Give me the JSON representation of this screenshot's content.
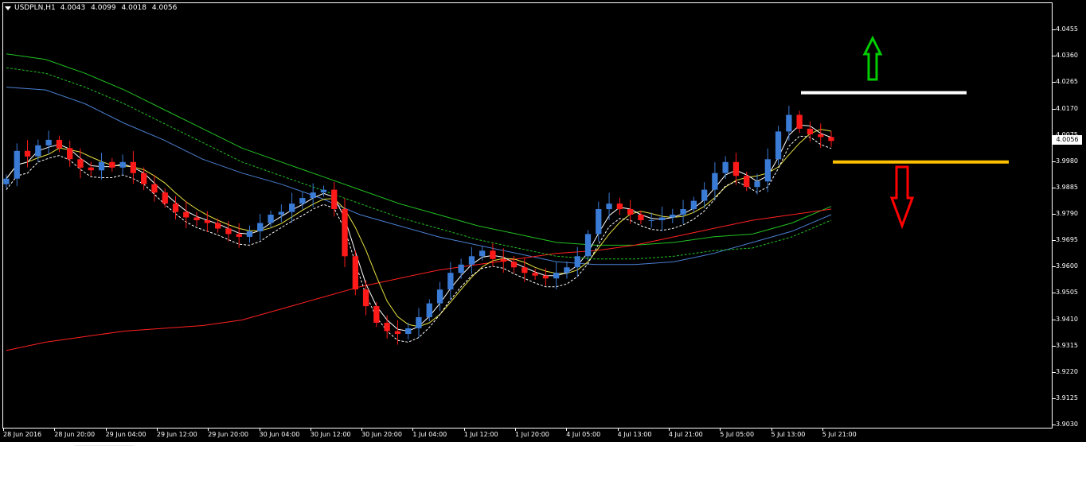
{
  "header": {
    "symbol": "USDPLN,H1",
    "open": "4.0043",
    "high": "4.0099",
    "low": "4.0018",
    "close": "4.0056"
  },
  "price_axis": {
    "labels": [
      "4.0455",
      "4.0360",
      "4.0265",
      "4.0170",
      "4.0075",
      "3.9980",
      "3.9885",
      "3.9790",
      "3.9695",
      "3.9600",
      "3.9505",
      "3.9410",
      "3.9315",
      "3.9220",
      "3.9125",
      "3.9030"
    ],
    "current_price": "4.0056"
  },
  "time_axis": {
    "labels": [
      "28 Jun 2016",
      "28 Jun 20:00",
      "29 Jun 04:00",
      "29 Jun 12:00",
      "29 Jun 20:00",
      "30 Jun 04:00",
      "30 Jun 12:00",
      "30 Jun 20:00",
      "1 Jul 04:00",
      "1 Jul 12:00",
      "1 Jul 20:00",
      "4 Jul 05:00",
      "4 Jul 13:00",
      "4 Jul 21:00",
      "5 Jul 05:00",
      "5 Jul 13:00",
      "5 Jul 21:00"
    ]
  },
  "colors": {
    "background": "#000000",
    "bull_candle": "#3a7bd5",
    "bear_candle": "#ff1a1a",
    "ma_green": "#22c022",
    "ma_red": "#ff2020",
    "ma_blue": "#4a7fd0",
    "ma_yellow": "#e8e040",
    "ma_white": "#ffffff",
    "resistance_line": "#ffffff",
    "support_line": "#ffc000",
    "up_arrow": "#00cc00",
    "down_arrow": "#ff0000"
  },
  "annotations": {
    "resistance_price": 4.023,
    "support_price": 3.998,
    "up_arrow_icon": "up-arrow-icon",
    "down_arrow_icon": "down-arrow-icon"
  },
  "chart_data": {
    "type": "candlestick",
    "ylim": [
      3.903,
      4.053
    ],
    "x_labels": [
      "28 Jun 2016",
      "28 Jun 20:00",
      "29 Jun 04:00",
      "29 Jun 12:00",
      "29 Jun 20:00",
      "30 Jun 04:00",
      "30 Jun 12:00",
      "30 Jun 20:00",
      "1 Jul 04:00",
      "1 Jul 12:00",
      "1 Jul 20:00",
      "4 Jul 05:00",
      "4 Jul 13:00",
      "4 Jul 21:00",
      "5 Jul 05:00",
      "5 Jul 13:00",
      "5 Jul 21:00"
    ],
    "close_series": [
      3.992,
      4.002,
      4.0,
      4.004,
      4.006,
      4.003,
      3.999,
      3.996,
      3.995,
      3.998,
      3.996,
      3.998,
      3.994,
      3.99,
      3.987,
      3.983,
      3.98,
      3.978,
      3.977,
      3.976,
      3.974,
      3.972,
      3.971,
      3.973,
      3.976,
      3.979,
      3.98,
      3.983,
      3.985,
      3.987,
      3.988,
      3.981,
      3.964,
      3.952,
      3.946,
      3.94,
      3.937,
      3.936,
      3.938,
      3.942,
      3.947,
      3.952,
      3.958,
      3.961,
      3.964,
      3.966,
      3.963,
      3.962,
      3.96,
      3.958,
      3.957,
      3.956,
      3.958,
      3.96,
      3.964,
      3.972,
      3.981,
      3.983,
      3.981,
      3.979,
      3.977,
      3.977,
      3.978,
      3.979,
      3.981,
      3.984,
      3.988,
      3.994,
      3.998,
      3.993,
      3.989,
      3.991,
      3.999,
      4.009,
      4.015,
      4.01,
      4.008,
      4.007,
      4.0056
    ],
    "series": [
      {
        "name": "MA green",
        "values": [
          4.037,
          4.035,
          4.03,
          4.024,
          4.017,
          4.01,
          4.003,
          3.998,
          3.993,
          3.988,
          3.983,
          3.979,
          3.975,
          3.972,
          3.969,
          3.968,
          3.968,
          3.969,
          3.971,
          3.972,
          3.976,
          3.982
        ]
      },
      {
        "name": "MA blue",
        "values": [
          4.025,
          4.024,
          4.019,
          4.012,
          4.006,
          3.999,
          3.994,
          3.99,
          3.985,
          3.979,
          3.975,
          3.971,
          3.968,
          3.965,
          3.962,
          3.961,
          3.961,
          3.962,
          3.965,
          3.969,
          3.973,
          3.979
        ]
      },
      {
        "name": "MA red",
        "values": [
          3.93,
          3.933,
          3.935,
          3.937,
          3.938,
          3.939,
          3.941,
          3.945,
          3.949,
          3.953,
          3.956,
          3.959,
          3.961,
          3.963,
          3.965,
          3.966,
          3.968,
          3.971,
          3.974,
          3.977,
          3.979,
          3.981
        ]
      }
    ]
  }
}
